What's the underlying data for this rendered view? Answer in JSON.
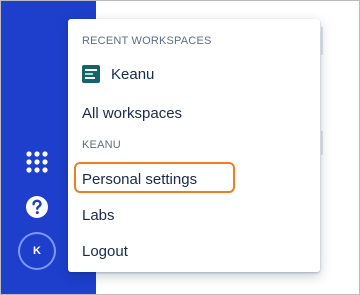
{
  "menu": {
    "recent_header": "RECENT WORKSPACES",
    "workspace_name": "Keanu",
    "all_workspaces": "All workspaces",
    "user_header": "KEANU",
    "personal_settings": "Personal settings",
    "labs": "Labs",
    "logout": "Logout"
  },
  "sidebar": {
    "avatar_initial": "K",
    "apps_icon": "grid-icon",
    "help_icon": "question-icon"
  },
  "colors": {
    "sidebar": "#1d3fcb",
    "highlight": "#f07d1f",
    "workspace_icon": "#15646a"
  }
}
